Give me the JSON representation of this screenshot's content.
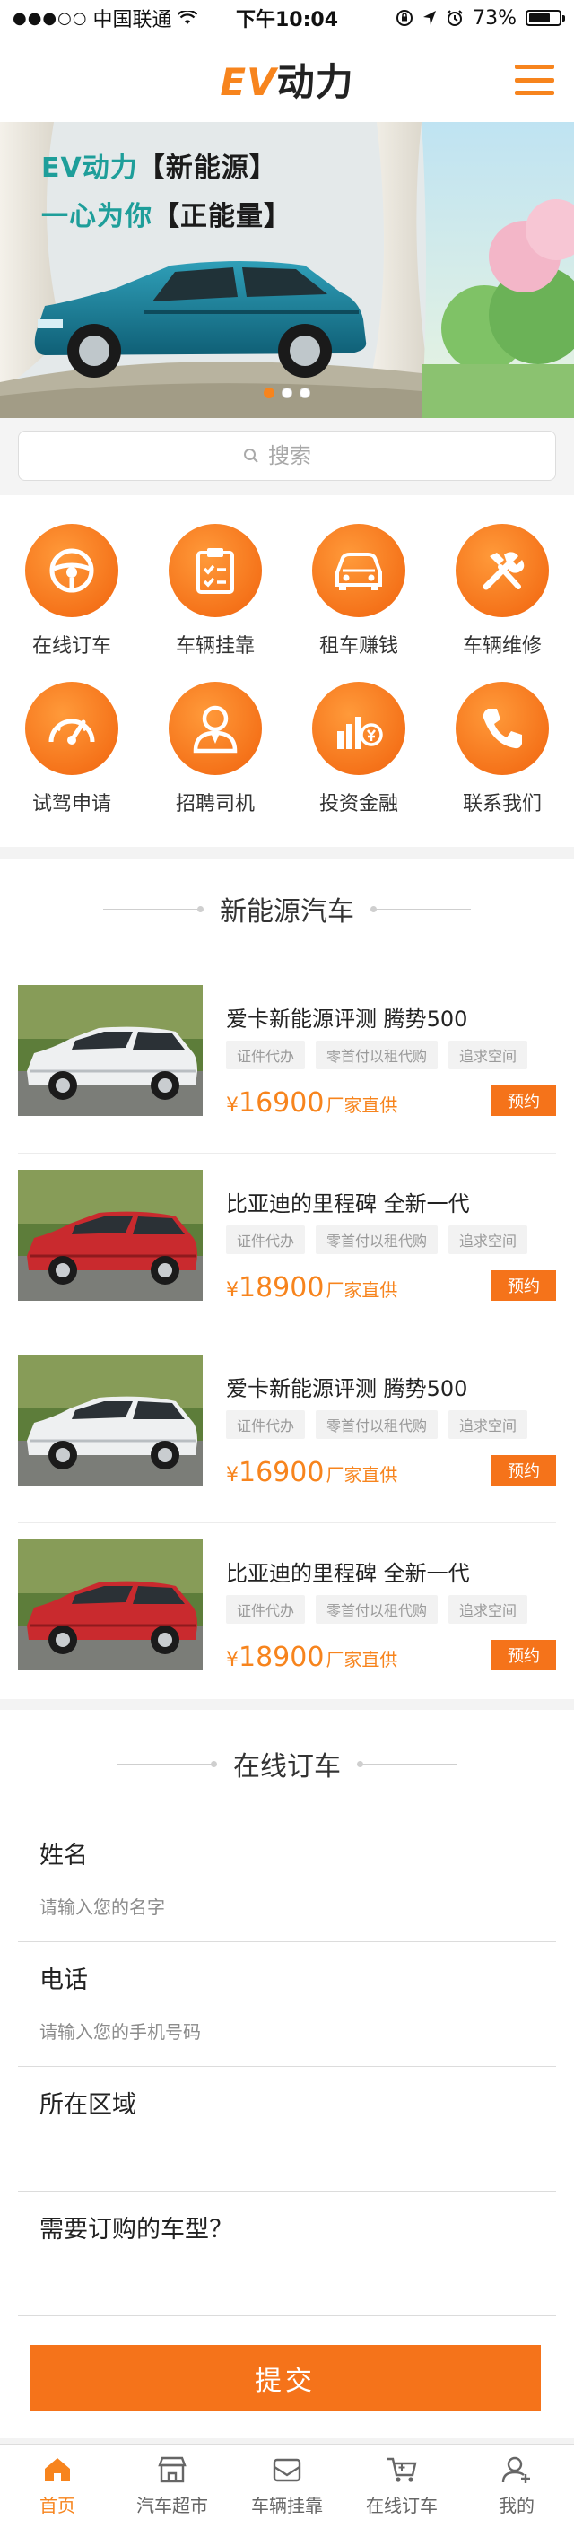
{
  "status_bar": {
    "carrier": "中国联通",
    "time": "下午10:04",
    "battery_text": "73%",
    "battery_level": 0.73
  },
  "header": {
    "logo_ev": "EV",
    "logo_rest": "动力"
  },
  "banner": {
    "line1_pre": "EV动力",
    "line1_hl": "【新能源】",
    "line2_pre": "一心为你",
    "line2_hl": "【正能量】",
    "slides": 3,
    "active_slide": 0
  },
  "search": {
    "placeholder": "搜索"
  },
  "nav": [
    {
      "label": "在线订车",
      "icon": "steering-wheel-icon"
    },
    {
      "label": "车辆挂靠",
      "icon": "clipboard-icon"
    },
    {
      "label": "租车赚钱",
      "icon": "car-front-icon"
    },
    {
      "label": "车辆维修",
      "icon": "tools-icon"
    },
    {
      "label": "试驾申请",
      "icon": "speedometer-icon"
    },
    {
      "label": "招聘司机",
      "icon": "driver-icon"
    },
    {
      "label": "投资金融",
      "icon": "finance-icon"
    },
    {
      "label": "联系我们",
      "icon": "phone-icon"
    }
  ],
  "cars_section": {
    "title": "新能源汽车",
    "items": [
      {
        "title": "爱卡新能源评测 腾势500",
        "tags": [
          "证件代办",
          "零首付以租代购",
          "追求空间"
        ],
        "yen": "¥",
        "price": "16900",
        "suffix": "厂家直供",
        "button": "预约",
        "car_color": "white"
      },
      {
        "title": "比亚迪的里程碑 全新一代",
        "tags": [
          "证件代办",
          "零首付以租代购",
          "追求空间"
        ],
        "yen": "¥",
        "price": "18900",
        "suffix": "厂家直供",
        "button": "预约",
        "car_color": "red"
      },
      {
        "title": "爱卡新能源评测 腾势500",
        "tags": [
          "证件代办",
          "零首付以租代购",
          "追求空间"
        ],
        "yen": "¥",
        "price": "16900",
        "suffix": "厂家直供",
        "button": "预约",
        "car_color": "white"
      },
      {
        "title": "比亚迪的里程碑 全新一代",
        "tags": [
          "证件代办",
          "零首付以租代购",
          "追求空间"
        ],
        "yen": "¥",
        "price": "18900",
        "suffix": "厂家直供",
        "button": "预约",
        "car_color": "red"
      }
    ]
  },
  "order_section": {
    "title": "在线订车",
    "name_label": "姓名",
    "name_placeholder": "请输入您的名字",
    "phone_label": "电话",
    "phone_placeholder": "请输入您的手机号码",
    "area_label": "所在区域",
    "model_label": "需要订购的车型？",
    "submit": "提交"
  },
  "tabbar": [
    {
      "label": "首页",
      "icon": "home-icon",
      "active": true
    },
    {
      "label": "汽车超市",
      "icon": "store-icon",
      "active": false
    },
    {
      "label": "车辆挂靠",
      "icon": "inbox-icon",
      "active": false
    },
    {
      "label": "在线订车",
      "icon": "cart-icon",
      "active": false
    },
    {
      "label": "我的",
      "icon": "user-icon",
      "active": false
    }
  ],
  "colors": {
    "accent": "#f7841d",
    "button": "#f5731a"
  }
}
